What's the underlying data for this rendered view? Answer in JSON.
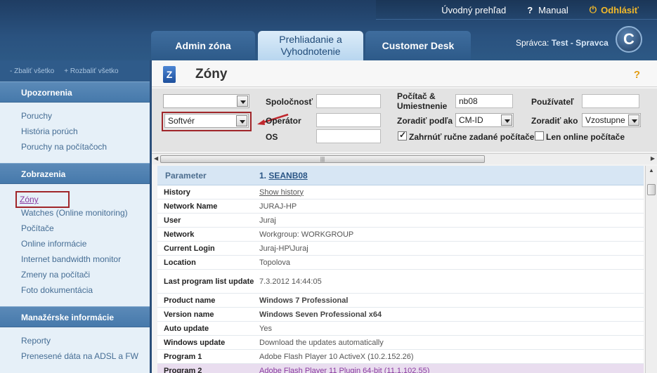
{
  "header": {
    "top_links": {
      "overview": "Úvodný prehľad",
      "help_mark": "?",
      "manual": "Manual",
      "logout": "Odhlásiť"
    },
    "tabs": [
      {
        "label": "Admin zóna"
      },
      {
        "label": "Prehliadanie a Vyhodnotenie"
      },
      {
        "label": "Customer Desk"
      }
    ],
    "admin_prefix": "Správca:",
    "admin_name": "Test - Spravca",
    "logo_letter": "C"
  },
  "sidebar": {
    "collapse_all": "- Zbaliť všetko",
    "expand_all": "+ Rozbaliť všetko",
    "sections": [
      {
        "title": "Upozornenia",
        "items": [
          "Poruchy",
          "História porúch",
          "Poruchy na počítačoch"
        ]
      },
      {
        "title": "Zobrazenia",
        "items": [
          "Zóny",
          "Watches (Online monitoring)",
          "Počítače",
          "Online informácie",
          "Internet bandwidth monitor",
          "Zmeny na počítači",
          "Foto dokumentácia"
        ]
      },
      {
        "title": "Manažérske informácie",
        "items": [
          "Reporty",
          "Prenesené dáta na ADSL a FW"
        ]
      }
    ]
  },
  "main": {
    "title": "Zóny",
    "help": "?",
    "filters": {
      "select1_value": "",
      "select2_value": "Softvér",
      "company_label": "Spoločnosť",
      "operator_label": "Operátor",
      "os_label": "OS",
      "computer_label": "Počítač & Umiestnenie",
      "computer_value": "nb08",
      "sort_by_label": "Zoradiť podľa",
      "sort_by_value": "CM-ID",
      "user_label": "Používateľ",
      "sort_as_label": "Zoradiť ako",
      "sort_as_value": "Vzostupne",
      "include_manual_label": "Zahrnúť ručne zadané počítače",
      "include_manual_checked": true,
      "online_only_label": "Len online počítače",
      "online_only_checked": false
    },
    "table": {
      "col_param": "Parameter",
      "col_value_prefix": "1.",
      "col_value": "SEANB08",
      "rows": [
        {
          "key": "History",
          "value": "Show history",
          "style": "link"
        },
        {
          "key": "Network Name",
          "value": "JURAJ-HP",
          "style": ""
        },
        {
          "key": "User",
          "value": "Juraj",
          "style": ""
        },
        {
          "key": "Network",
          "value": "Workgroup: WORKGROUP",
          "style": ""
        },
        {
          "key": "Current Login",
          "value": "Juraj-HP\\Juraj",
          "style": ""
        },
        {
          "key": "Location",
          "value": "Topolova",
          "style": ""
        },
        {
          "key": "Last program list update",
          "value": "7.3.2012 14:44:05",
          "style": "tall"
        },
        {
          "key": "Product name",
          "value": "Windows 7 Professional",
          "style": "bold"
        },
        {
          "key": "Version name",
          "value": "Windows Seven Professional x64",
          "style": "bold"
        },
        {
          "key": "Auto update",
          "value": "Yes",
          "style": ""
        },
        {
          "key": "Windows update",
          "value": "Download the updates automatically",
          "style": ""
        },
        {
          "key": "Program 1",
          "value": "Adobe Flash Player 10 ActiveX (10.2.152.26)",
          "style": ""
        },
        {
          "key": "Program 2",
          "value": "Adobe Flash Player 11 Plugin 64-bit (11.1.102.55)",
          "style": "alt"
        }
      ]
    }
  }
}
